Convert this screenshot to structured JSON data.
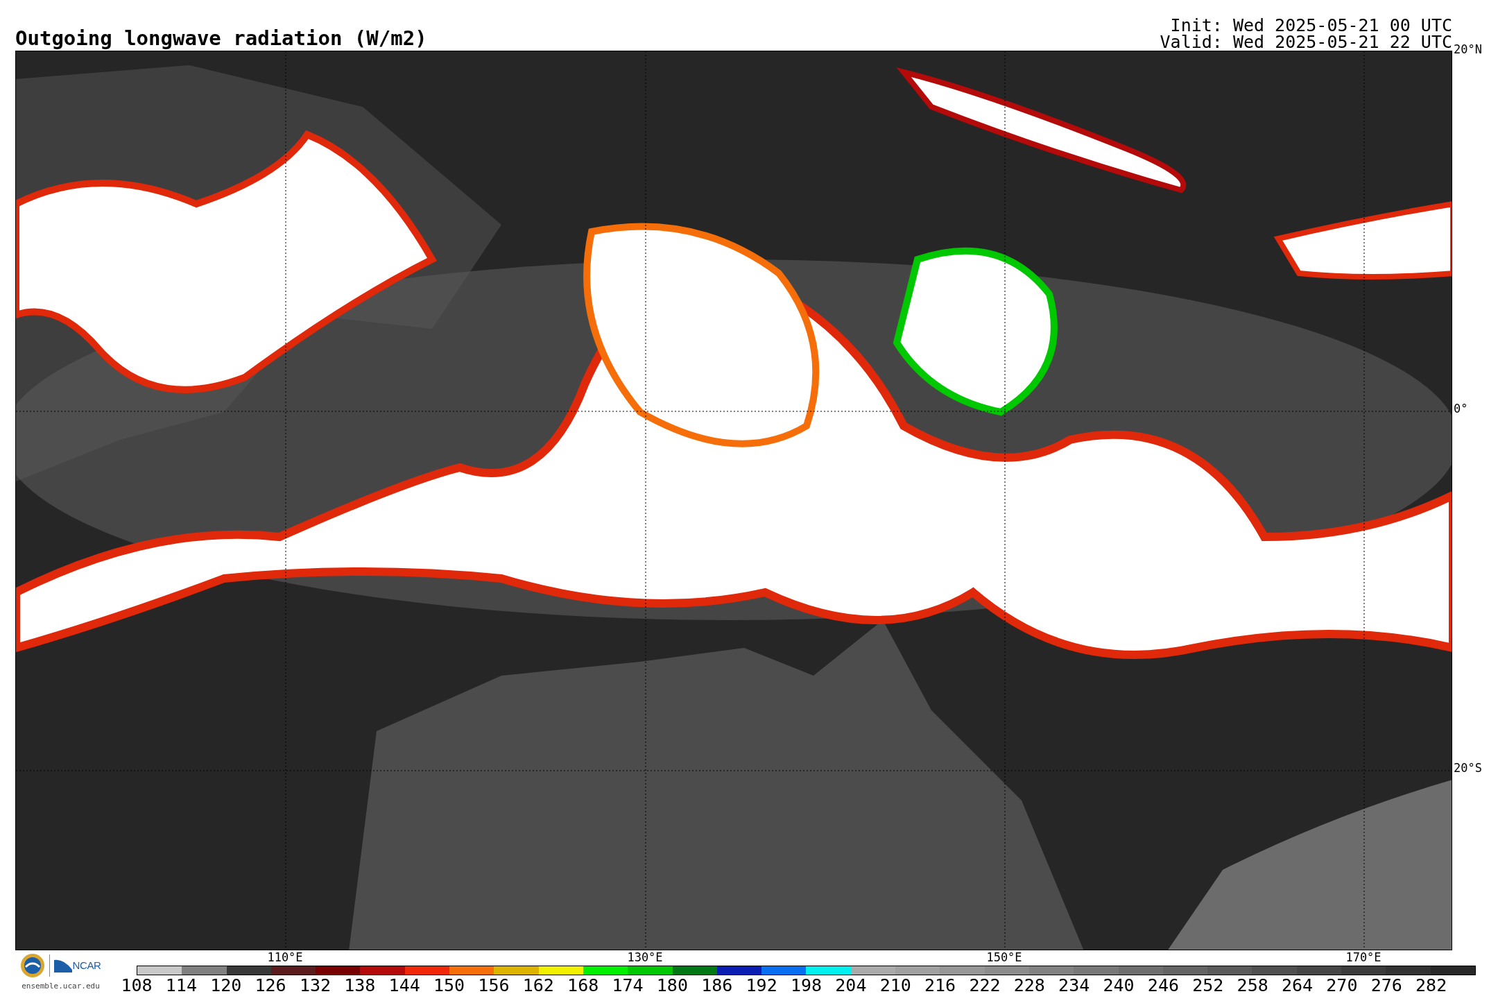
{
  "title": "Outgoing longwave radiation (W/m2)",
  "init": "Init: Wed 2025-05-21 00 UTC",
  "valid": "Valid: Wed 2025-05-21 22 UTC",
  "map": {
    "lat_labels": [
      "20°N",
      "0°",
      "20°S"
    ],
    "lon_labels": [
      "110°E",
      "130°E",
      "150°E",
      "170°E"
    ]
  },
  "logos": {
    "ncar": "NCAR",
    "url": "ensemble.ucar.edu"
  },
  "colorbar": {
    "ticks": [
      "108",
      "114",
      "120",
      "126",
      "132",
      "138",
      "144",
      "150",
      "156",
      "162",
      "168",
      "174",
      "180",
      "186",
      "192",
      "198",
      "204",
      "210",
      "216",
      "222",
      "228",
      "234",
      "240",
      "246",
      "252",
      "258",
      "264",
      "270",
      "276",
      "282"
    ],
    "segments": [
      {
        "color": "#c8c8c8"
      },
      {
        "color": "#808080"
      },
      {
        "color": "#383838"
      },
      {
        "color": "#5a1c1c"
      },
      {
        "color": "#780000"
      },
      {
        "color": "#b40a0a"
      },
      {
        "color": "#f0280a"
      },
      {
        "color": "#f56e0a"
      },
      {
        "color": "#dcb400"
      },
      {
        "color": "#f0f000"
      },
      {
        "color": "#00f000"
      },
      {
        "color": "#00c800"
      },
      {
        "color": "#007814"
      },
      {
        "color": "#0a1eb4"
      },
      {
        "color": "#0a6ef0"
      },
      {
        "color": "#00f0f0"
      },
      {
        "color": "#aaaaaa"
      },
      {
        "color": "#a0a0a0"
      },
      {
        "color": "#969696"
      },
      {
        "color": "#8c8c8c"
      },
      {
        "color": "#828282"
      },
      {
        "color": "#787878"
      },
      {
        "color": "#6e6e6e"
      },
      {
        "color": "#646464"
      },
      {
        "color": "#5a5a5a"
      },
      {
        "color": "#505050"
      },
      {
        "color": "#464646"
      },
      {
        "color": "#3c3c3c"
      },
      {
        "color": "#323232"
      },
      {
        "color": "#282828"
      }
    ]
  }
}
